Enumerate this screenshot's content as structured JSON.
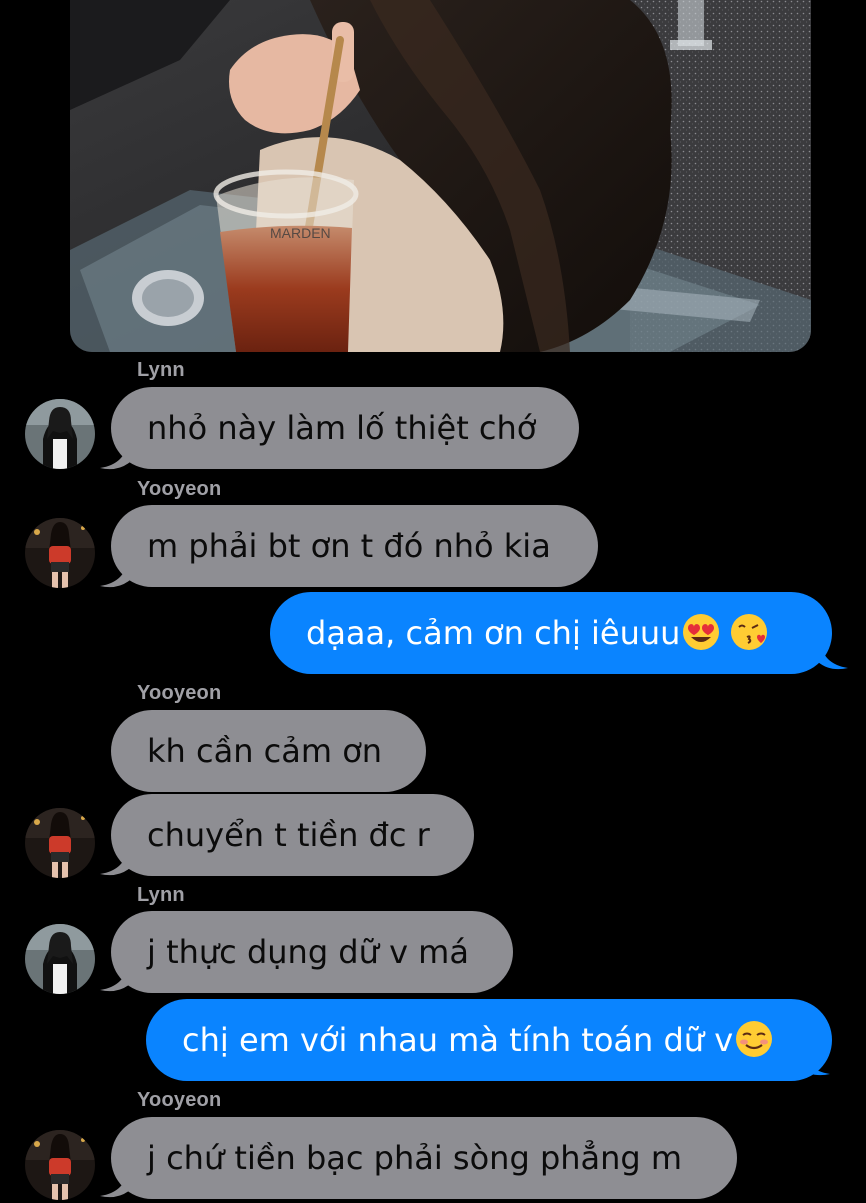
{
  "conversation": {
    "messages": [
      {
        "sender": "Lynn",
        "text": "nhỏ này làm lố thiệt chớ"
      },
      {
        "sender": "Yooyeon",
        "text": "m phải bt ơn t đó nhỏ kia"
      },
      {
        "sender": "me",
        "text": "dạaa, cảm ơn chị iêuuu",
        "emoji": [
          "smiling-face-with-heart-eyes",
          "face-blowing-a-kiss"
        ]
      },
      {
        "sender": "Yooyeon",
        "text": "kh cần cảm ơn"
      },
      {
        "sender": "Yooyeon",
        "text": "chuyển t tiền đc r"
      },
      {
        "sender": "Lynn",
        "text": "j thực dụng dữ v má"
      },
      {
        "sender": "me",
        "text": "chị em với nhau mà tính toán dữ v",
        "emoji": [
          "smiling-face"
        ]
      },
      {
        "sender": "Yooyeon",
        "text": "j chứ tiền bạc phải sòng phẳng m"
      }
    ],
    "sender_labels": [
      "Lynn",
      "Yooyeon",
      "Yooyeon",
      "Lynn",
      "Yooyeon"
    ]
  },
  "colors": {
    "background": "#000000",
    "incoming_bubble": "#8e8e93",
    "outgoing_bubble": "#0a84ff",
    "sender_name": "#a0a0a6"
  }
}
